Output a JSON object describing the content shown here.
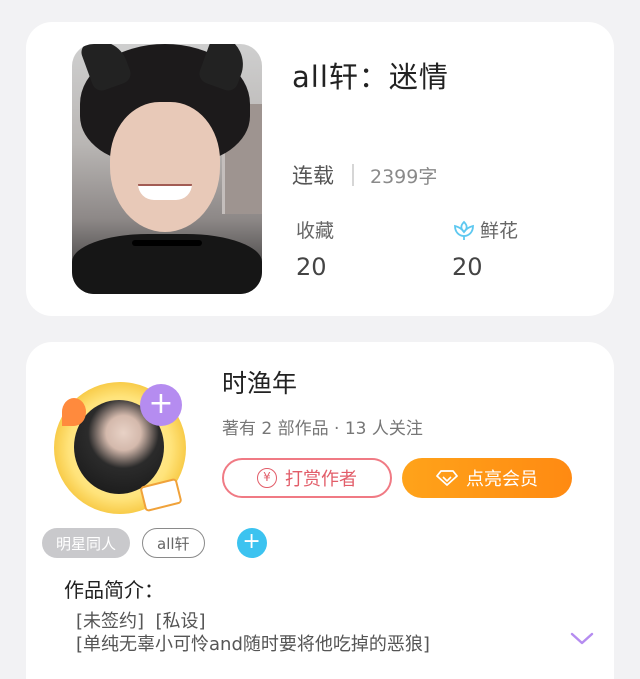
{
  "book": {
    "title": "all轩：迷情",
    "status": "连载",
    "word_count": "2399字",
    "favorites_label": "收藏",
    "favorites_count": "20",
    "flowers_label": "鲜花",
    "flowers_count": "20",
    "flower_icon_color": "#5ec8f0"
  },
  "author": {
    "name": "时渔年",
    "stats": "著有 2 部作品 · 13 人关注",
    "follow_button": "+",
    "tip_button": "打赏作者",
    "tip_icon_glyph": "¥",
    "vip_button": "点亮会员"
  },
  "tags": [
    "明星同人",
    "all轩"
  ],
  "tag_add": "+",
  "intro": {
    "heading": "作品简介：",
    "line1": "[未签约]  [私设]",
    "line2": "[单纯无辜小可怜and随时要将他吃掉的恶狼]"
  },
  "colors": {
    "accent_orange": "#ff8a12",
    "tip_red": "#e25d69",
    "follow_purple": "#b58cf0",
    "tag_add_blue": "#3cc3f0",
    "expand_purple": "#b58cf0"
  }
}
